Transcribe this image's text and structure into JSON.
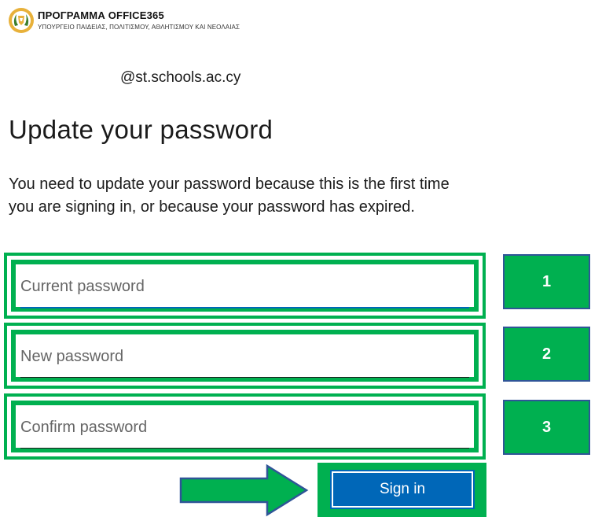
{
  "brand": {
    "title": "ΠΡΟΓΡΑΜΜΑ OFFICE365",
    "subtitle": "ΥΠΟΥΡΓΕΙΟ ΠΑΙΔΕΙΑΣ, ΠΟΛΙΤΙΣΜΟΥ, ΑΘΛΗΤΙΣΜΟΥ ΚΑΙ ΝΕΟΛΑΙΑΣ",
    "emblem_icon": "cyprus-emblem-icon"
  },
  "account": "@st.schools.ac.cy",
  "heading": "Update your password",
  "description": "You need to update your password because this is the first time you are signing in, or because your password has expired.",
  "fields": {
    "current": {
      "placeholder": "Current password",
      "step": "1"
    },
    "new": {
      "placeholder": "New password",
      "step": "2"
    },
    "confirm": {
      "placeholder": "Confirm password",
      "step": "3"
    }
  },
  "signin": {
    "label": "Sign in"
  },
  "arrow_icon": "right-arrow-icon",
  "colors": {
    "highlight": "#00b050",
    "button": "#0067b8",
    "badge_border": "#2f5597",
    "focus_line": "#0067b8"
  }
}
